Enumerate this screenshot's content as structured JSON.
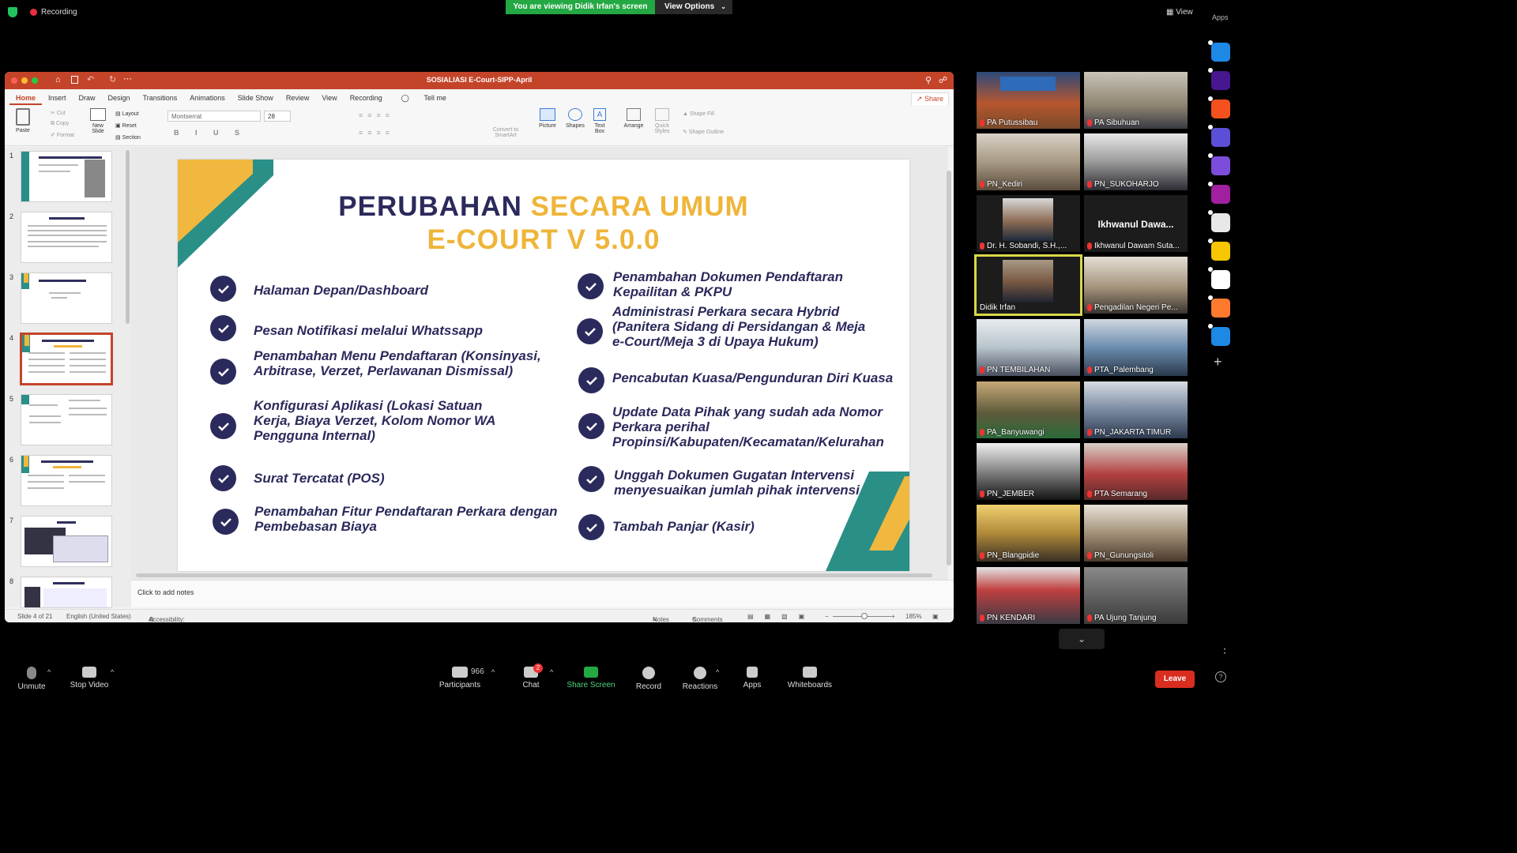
{
  "zoom": {
    "recording_label": "Recording",
    "viewing_banner": "You are viewing Didik Irfan's screen",
    "view_options": "View Options",
    "view_label": "View",
    "apps_label": "Apps"
  },
  "ppt": {
    "title": "SOSIALIASI E-Court-SIPP-April",
    "menu": [
      "Home",
      "Insert",
      "Draw",
      "Design",
      "Transitions",
      "Animations",
      "Slide Show",
      "Review",
      "View",
      "Recording",
      "Tell me"
    ],
    "share": "Share",
    "ribbon": {
      "paste": "Paste",
      "cut": "Cut",
      "copy": "Copy",
      "format": "Format",
      "new_slide": "New Slide",
      "layout": "Layout",
      "reset": "Reset",
      "section": "Section",
      "font": "Montserrat",
      "font_size": "28",
      "convert": "Convert to SmartArt",
      "picture": "Picture",
      "shapes": "Shapes",
      "text_box": "Text Box",
      "arrange": "Arrange",
      "quick_styles": "Quick Styles",
      "shape_fill": "Shape Fill",
      "shape_outline": "Shape Outline"
    },
    "thumb_numbers": [
      "1",
      "2",
      "3",
      "4",
      "5",
      "6",
      "7",
      "8"
    ],
    "notes_placeholder": "Click to add notes",
    "status": {
      "slide": "Slide 4 of 21",
      "language": "English (United States)",
      "accessibility": "Accessibility: Investigate",
      "notes": "Notes",
      "comments": "Comments",
      "zoom": "185%"
    }
  },
  "slide": {
    "title_dark": "PERUBAHAN",
    "title_gold": "SECARA UMUM",
    "subtitle": "E-COURT V 5.0.0",
    "left_items": [
      "Halaman Depan/Dashboard",
      "Pesan Notifikasi melalui Whatssapp",
      "Penambahan Menu Pendaftaran (Konsinyasi, Arbitrase, Verzet, Perlawanan Dismissal)",
      "Konfigurasi Aplikasi (Lokasi Satuan Kerja, Biaya Verzet, Kolom Nomor WA Pengguna Internal)",
      "Surat Tercatat (POS)",
      "Penambahan Fitur Pendaftaran Perkara dengan Pembebasan Biaya"
    ],
    "right_items": [
      "Penambahan Dokumen Pendaftaran Kepailitan & PKPU",
      "Administrasi Perkara secara Hybrid (Panitera Sidang di Persidangan & Meja e-Court/Meja 3 di Upaya Hukum)",
      "Pencabutan Kuasa/Pengunduran Diri Kuasa",
      "Update Data Pihak yang sudah ada Nomor Perkara perihal Propinsi/Kabupaten/Kecamatan/Kelurahan",
      "Unggah Dokumen Gugatan Intervensi menyesuaikan jumlah pihak intervensi",
      "Tambah Panjar (Kasir)"
    ]
  },
  "gallery": [
    {
      "name": "PA Putussibau",
      "muted": true
    },
    {
      "name": "PA Sibuhuan",
      "muted": true
    },
    {
      "name": "PN_Kediri",
      "muted": true
    },
    {
      "name": "PN_SUKOHARJO",
      "muted": true
    },
    {
      "name": "Dr. H. Sobandi, S.H.,...",
      "muted": true
    },
    {
      "name": "Ikhwanul Dawam Suta...",
      "muted": true,
      "placeholder": "Ikhwanul  Dawa..."
    },
    {
      "name": "Didik Irfan",
      "muted": false
    },
    {
      "name": "Pengadilan Negeri Pe...",
      "muted": true
    },
    {
      "name": "PN TEMBILAHAN",
      "muted": true
    },
    {
      "name": "PTA_Palembang",
      "muted": true
    },
    {
      "name": "PA_Banyuwangi",
      "muted": true
    },
    {
      "name": "PN_JAKARTA TIMUR",
      "muted": true
    },
    {
      "name": "PN_JEMBER",
      "muted": true
    },
    {
      "name": "PTA Semarang",
      "muted": true
    },
    {
      "name": "PN_Blangpidie",
      "muted": true
    },
    {
      "name": "PN_Gunungsitoli",
      "muted": true
    },
    {
      "name": "PN KENDARI",
      "muted": true
    },
    {
      "name": "PA Ujung Tanjung",
      "muted": true
    }
  ],
  "toolbar": {
    "unmute": "Unmute",
    "stop_video": "Stop Video",
    "participants": "Participants",
    "participants_count": "966",
    "chat": "Chat",
    "chat_badge": "2",
    "share_screen": "Share Screen",
    "record": "Record",
    "reactions": "Reactions",
    "apps": "Apps",
    "whiteboards": "Whiteboards",
    "leave": "Leave"
  },
  "colors": {
    "ppt_accent": "#c4442a",
    "slide_navy": "#2b2a5c",
    "slide_gold": "#efb539",
    "slide_teal": "#2a8f87",
    "leave_red": "#d92d20",
    "zoom_green": "#23a843"
  }
}
